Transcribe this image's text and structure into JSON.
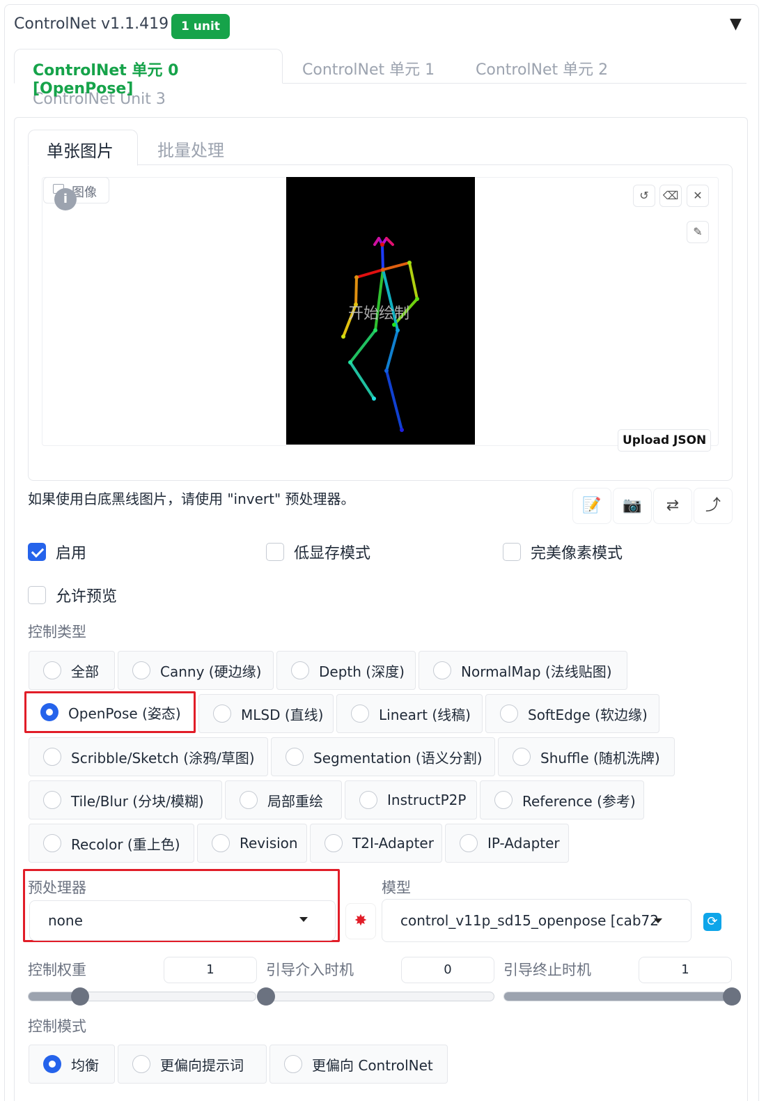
{
  "header": {
    "title": "ControlNet v1.1.419",
    "badge": "1 unit",
    "collapse_glyph": "▼"
  },
  "unit_tabs": [
    {
      "label": "ControlNet 单元 0 [OpenPose]",
      "active": true
    },
    {
      "label": "ControlNet 单元 1",
      "active": false
    },
    {
      "label": "ControlNet 单元 2",
      "active": false
    },
    {
      "label": "ControlNet Unit 3",
      "active": false
    }
  ],
  "image_tabs": [
    {
      "label": "单张图片",
      "active": true
    },
    {
      "label": "批量处理",
      "active": false
    }
  ],
  "canvas": {
    "image_label": "图像",
    "info_glyph": "i",
    "draw_hint": "开始绘制",
    "upload_json_label": "Upload JSON",
    "tool_icons": [
      "undo-icon",
      "eraser-icon",
      "close-icon",
      "brush-icon"
    ]
  },
  "hint_text": "如果使用白底黑线图片，请使用 \"invert\" 预处理器。",
  "actions": [
    "edit-icon",
    "camera-icon",
    "swap-icon",
    "send-icon"
  ],
  "checkboxes": {
    "enable": {
      "label": "启用",
      "checked": true
    },
    "low_vram": {
      "label": "低显存模式",
      "checked": false
    },
    "pixel_perfect": {
      "label": "完美像素模式",
      "checked": false
    },
    "allow_preview": {
      "label": "允许预览",
      "checked": false
    }
  },
  "control_type": {
    "label": "控制类型",
    "selected": "OpenPose (姿态)",
    "options": [
      "全部",
      "Canny (硬边缘)",
      "Depth (深度)",
      "NormalMap (法线贴图)",
      "OpenPose (姿态)",
      "MLSD (直线)",
      "Lineart (线稿)",
      "SoftEdge (软边缘)",
      "Scribble/Sketch (涂鸦/草图)",
      "Segmentation (语义分割)",
      "Shuffle (随机洗牌)",
      "Tile/Blur (分块/模糊)",
      "局部重绘",
      "InstructP2P",
      "Reference (参考)",
      "Recolor (重上色)",
      "Revision",
      "T2I-Adapter",
      "IP-Adapter"
    ]
  },
  "preprocessor": {
    "label": "预处理器",
    "value": "none"
  },
  "model": {
    "label": "模型",
    "value": "control_v11p_sd15_openpose [cab72"
  },
  "sliders": {
    "weight": {
      "label": "控制权重",
      "value": "1",
      "fraction": 0.23
    },
    "start": {
      "label": "引导介入时机",
      "value": "0",
      "fraction": 0.0
    },
    "end": {
      "label": "引导终止时机",
      "value": "1",
      "fraction": 1.0
    }
  },
  "control_mode": {
    "label": "控制模式",
    "selected": "均衡",
    "options": [
      "均衡",
      "更偏向提示词",
      "更偏向 ControlNet"
    ]
  },
  "colors": {
    "accent_green": "#16a34a",
    "accent_blue": "#2563eb",
    "highlight_red": "#e11d28"
  }
}
